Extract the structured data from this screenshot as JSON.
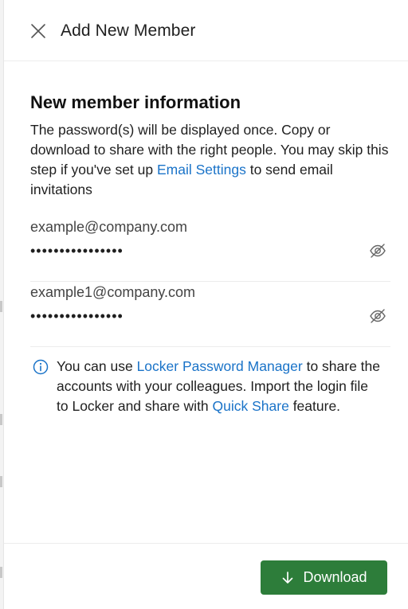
{
  "header": {
    "title": "Add New Member",
    "close_icon": "close-icon"
  },
  "info_section": {
    "heading": "New member information",
    "desc_part1": "The password(s) will be displayed once. Copy or download to share with the right people. You may skip this step if you've set up ",
    "desc_link": "Email Settings",
    "desc_part2": " to send email invitations"
  },
  "members": [
    {
      "email": "example@company.com",
      "password_masked": "••••••••••••••••",
      "visibility_icon": "eye-hidden-icon"
    },
    {
      "email": "example1@company.com",
      "password_masked": "••••••••••••••••",
      "visibility_icon": "eye-hidden-icon"
    }
  ],
  "tip": {
    "icon": "info-icon",
    "part1": "You can use ",
    "link1": "Locker Password Manager",
    "part2": " to share the accounts with your colleagues. Import the login file to Locker and share with ",
    "link2": "Quick Share",
    "part3": " feature."
  },
  "footer": {
    "download_label": "Download",
    "download_icon": "arrow-down-icon"
  },
  "colors": {
    "link": "#1a73c8",
    "primary_button": "#2d7d3a"
  }
}
